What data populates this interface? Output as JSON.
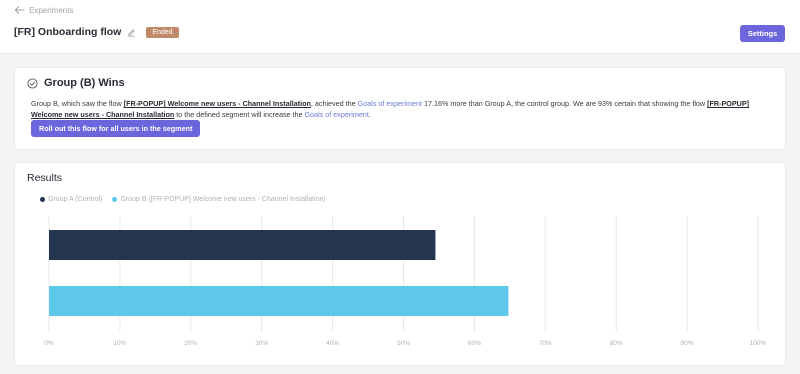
{
  "header": {
    "back_label": "Experiments",
    "title": "[FR] Onboarding flow",
    "status": "Ended",
    "settings_label": "Settings"
  },
  "winner": {
    "title": "Group (B) Wins",
    "desc_1": "Group B, which saw the flow ",
    "flow_name": "[FR-POPUP] Welcome new users - Channel Installation",
    "desc_2": ", achieved the ",
    "goals_link": "Goals of experiment",
    "desc_3": " 17.16% more than Group A, the control group. We are 93% certain that showing the flow ",
    "desc_4": " to the defined segment will increase the ",
    "desc_5": ".",
    "rollout_label": "Roll out this flow for all users in the segment"
  },
  "results": {
    "title": "Results"
  },
  "colors": {
    "accent": "#6b66db",
    "group_a": "#253550",
    "group_b": "#5ec8e8",
    "badge": "#c08a6a"
  },
  "chart_data": {
    "type": "bar",
    "orientation": "horizontal",
    "categories": [
      "Group A (Control)",
      "Group B ([FR-POPUP] Welcome new users - Channel Installation)"
    ],
    "series": [
      {
        "name": "Group A (Control)",
        "values": [
          54.5
        ]
      },
      {
        "name": "Group B ([FR-POPUP] Welcome new users - Channel Installation)",
        "values": [
          64.8
        ]
      }
    ],
    "xlim": [
      0,
      100
    ],
    "ticks": [
      "0%",
      "10%",
      "20%",
      "30%",
      "40%",
      "50%",
      "60%",
      "70%",
      "80%",
      "90%",
      "100%"
    ],
    "legend_position": "top-left",
    "grid": true
  }
}
